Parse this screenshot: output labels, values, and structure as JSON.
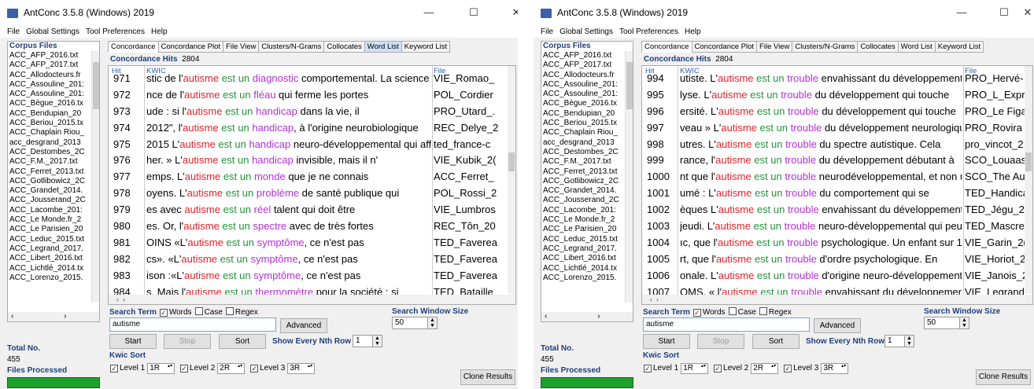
{
  "windows": [
    {
      "title": "AntConc 3.5.8 (Windows) 2019",
      "menu": [
        "File",
        "Global Settings",
        "Tool Preferences",
        "Help"
      ],
      "corpus_files_label": "Corpus Files",
      "files": [
        "ACC_AFP_2016.txt",
        "ACC_AFP_2017.txt",
        "ACC_Allodocteurs.fr",
        "ACC_Assouline_201:",
        "ACC_Assouline_201:",
        "ACC_Bègue_2016.tx",
        "ACC_Bendupian_20",
        "ACC_Beriou_2015.tx",
        "ACC_Chaplain Riou_",
        "acc_desgrand_2013",
        "ACC_Destombes_2C",
        "ACC_F.M._2017.txt",
        "ACC_Ferret_2013.txt",
        "ACC_Gotlibowicz_2C",
        "ACC_Grandet_2014.",
        "ACC_Jousserand_2C",
        "ACC_Lacombe_201:",
        "ACC_Le Monde.fr_2",
        "ACC_Le Parisien_20",
        "ACC_Leduc_2015.txt",
        "ACC_Legrand_2017.",
        "ACC_Libert_2016.txt",
        "ACC_Lichtlé_2014.tx",
        "ACC_Lorenzo_2015."
      ],
      "total_no_label": "Total No.",
      "total_no": "455",
      "files_processed_label": "Files Processed",
      "tabs": [
        "Concordance",
        "Concordance Plot",
        "File View",
        "Clusters/N-Grams",
        "Collocates",
        "Word List",
        "Keyword List"
      ],
      "concordance_hits_label": "Concordance Hits",
      "concordance_hits": "2804",
      "col_hit": "Hit",
      "col_kwic": "KWIC",
      "col_file": "File",
      "rows": [
        {
          "hit": "971",
          "left": "stic de l'",
          "t1": "autisme",
          "t2": "est",
          "t3": "un",
          "t3w": "diagnostic",
          "right": " comportemental. La science d",
          "file": "VIE_Romao_"
        },
        {
          "hit": "972",
          "left": "nce de l'",
          "t1": "autisme",
          "t2": "est",
          "t3": "un",
          "t3w": "fléau",
          "right": " qui ferme les portes",
          "file": "POL_Cordier"
        },
        {
          "hit": "973",
          "left": "ude : si l'",
          "t1": "autisme",
          "t2": "est",
          "t3": "un",
          "t3w": "handicap",
          "right": " dans la vie, il",
          "file": "PRO_Utard_."
        },
        {
          "hit": "974",
          "left": " 2012\", l'",
          "t1": "autisme",
          "t2": "est",
          "t3": "un",
          "t3w": "handicap",
          "right": ", à l'origine neurobiologique",
          "file": "REC_Delye_2"
        },
        {
          "hit": "975",
          "left": " 2015  L'",
          "t1": "autisme",
          "t2": "est",
          "t3": "un",
          "t3w": "handicap",
          "right": " neuro-développemental qui aff",
          "file": "ted_france-c"
        },
        {
          "hit": "976",
          "left": "her. »  L'",
          "t1": "autisme",
          "t2": "est",
          "t3": "un",
          "t3w": "handicap",
          "right": " invisible, mais il n'",
          "file": "VIE_Kubik_2("
        },
        {
          "hit": "977",
          "left": "emps. L'",
          "t1": "autisme",
          "t2": "est",
          "t3": "un",
          "t3w": "monde",
          "right": " que je ne connais",
          "file": "ACC_Ferret_"
        },
        {
          "hit": "978",
          "left": "oyens. L'",
          "t1": "autisme",
          "t2": "est",
          "t3": "un",
          "t3w": "problème",
          "right": " de santé publique qui",
          "file": "POL_Rossi_2"
        },
        {
          "hit": "979",
          "left": "es avec ",
          "t1": "autisme",
          "t2": "est",
          "t3": "un",
          "t3w": "réel",
          "right": " talent qui doit être",
          "file": "VIE_Lumbros"
        },
        {
          "hit": "980",
          "left": "es. Or, l'",
          "t1": "autisme",
          "t2": "est",
          "t3": "un",
          "t3w": "spectre",
          "right": " avec de très fortes",
          "file": "REC_Tôn_20"
        },
        {
          "hit": "981",
          "left": "OINS «L'",
          "t1": "autisme",
          "t2": "est",
          "t3": "un",
          "t3w": "symptôme",
          "right": ", ce n'est pas",
          "file": "TED_Faverea"
        },
        {
          "hit": "982",
          "left": "cs».  «L'",
          "t1": "autisme",
          "t2": "est",
          "t3": "un",
          "t3w": "symptôme",
          "right": ", ce n'est pas",
          "file": "TED_Faverea"
        },
        {
          "hit": "983",
          "left": "ison :«L'",
          "t1": "autisme",
          "t2": "est",
          "t3": "un",
          "t3w": "symptôme",
          "right": ", ce n'est pas",
          "file": "TED_Faverea"
        },
        {
          "hit": "984",
          "left": "s. Mais l'",
          "t1": "autisme",
          "t2": "est",
          "t3": "un",
          "t3w": "thermomètre",
          "right": " pour la société : si",
          "file": "TED_Bataille"
        }
      ],
      "search_term_label": "Search Term",
      "words_label": "Words",
      "case_label": "Case",
      "regex_label": "Regex",
      "search_value": "autisme",
      "advanced_label": "Advanced",
      "search_window_label": "Search Window Size",
      "search_window_value": "50",
      "start_label": "Start",
      "stop_label": "Stop",
      "sort_label": "Sort",
      "nth_row_label": "Show Every Nth Row",
      "nth_row_value": "1",
      "kwic_sort_label": "Kwic Sort",
      "level1_label": "Level 1",
      "level1_value": "1R",
      "level2_label": "Level 2",
      "level2_value": "2R",
      "level3_label": "Level 3",
      "level3_value": "3R",
      "clone_label": "Clone Results"
    },
    {
      "title": "AntConc 3.5.8 (Windows) 2019",
      "menu": [
        "File",
        "Global Settings",
        "Tool Preferences",
        "Help"
      ],
      "corpus_files_label": "Corpus Files",
      "files": [
        "ACC_AFP_2016.txt",
        "ACC_AFP_2017.txt",
        "ACC_Allodocteurs.fr",
        "ACC_Assouline_201:",
        "ACC_Assouline_201:",
        "ACC_Bègue_2016.tx",
        "ACC_Bendupian_20",
        "ACC_Beriou_2015.tx",
        "ACC_Chaplain Riou_",
        "acc_desgrand_2013",
        "ACC_Destombes_2C",
        "ACC_F.M._2017.txt",
        "ACC_Ferret_2013.txt",
        "ACC_Gotlibowicz_2C",
        "ACC_Grandet_2014.",
        "ACC_Jousserand_2C",
        "ACC_Lacombe_201:",
        "ACC_Le Monde.fr_2",
        "ACC_Le Parisien_20",
        "ACC_Leduc_2015.txt",
        "ACC_Legrand_2017.",
        "ACC_Libert_2016.txt",
        "ACC_Lichtlé_2014.tx",
        "ACC_Lorenzo_2015."
      ],
      "total_no_label": "Total No.",
      "total_no": "455",
      "files_processed_label": "Files Processed",
      "tabs": [
        "Concordance",
        "Concordance Plot",
        "File View",
        "Clusters/N-Grams",
        "Collocates",
        "Word List",
        "Keyword List"
      ],
      "concordance_hits_label": "Concordance Hits",
      "concordance_hits": "2804",
      "col_hit": "Hit",
      "col_kwic": "KWIC",
      "col_file": "File",
      "rows": [
        {
          "hit": "994",
          "left": "utiste. L'",
          "t1": "autisme",
          "t2": "est",
          "t3": "un",
          "t3w": "trouble",
          "right": " envahissant du développement. J",
          "file": "PRO_Hervé-"
        },
        {
          "hit": "995",
          "left": "lyse.  L'",
          "t1": "autisme",
          "t2": "est",
          "t3": "un",
          "t3w": "trouble",
          "right": " du développement qui touche",
          "file": "PRO_L_Expre"
        },
        {
          "hit": "996",
          "left": "ersité. L'",
          "t1": "autisme",
          "t2": "est",
          "t3": "un",
          "t3w": "trouble",
          "right": " du développement qui touche",
          "file": "PRO_Le Figa"
        },
        {
          "hit": "997",
          "left": "veau » L'",
          "t1": "autisme",
          "t2": "est",
          "t3": "un",
          "t3w": "trouble",
          "right": " du développement neurologique",
          "file": "PRO_Rovira"
        },
        {
          "hit": "998",
          "left": "utres. L'",
          "t1": "autisme",
          "t2": "est",
          "t3": "un",
          "t3w": "trouble",
          "right": " du spectre autistique. Cela",
          "file": "pro_vincot_2"
        },
        {
          "hit": "999",
          "left": "rance, l'",
          "t1": "autisme",
          "t2": "est",
          "t3": "un",
          "t3w": "trouble",
          "right": " du développement débutant à",
          "file": "SCO_Louaas"
        },
        {
          "hit": "1000",
          "left": "nt que l'",
          "t1": "autisme",
          "t2": "est",
          "t3": "un",
          "t3w": "trouble",
          "right": " neurodéveloppemental, et non un",
          "file": "SCO_The Au"
        },
        {
          "hit": "1001",
          "left": "umé : L'",
          "t1": "autisme",
          "t2": "est",
          "t3": "un",
          "t3w": "trouble",
          "right": " du comportement qui se",
          "file": "TED_Handica"
        },
        {
          "hit": "1002",
          "left": "èques  L'",
          "t1": "autisme",
          "t2": "est",
          "t3": "un",
          "t3w": "trouble",
          "right": " envahissant du développement  \\",
          "file": "TED_Jégu_2("
        },
        {
          "hit": "1003",
          "left": "jeudi.  L'",
          "t1": "autisme",
          "t2": "est",
          "t3": "un",
          "t3w": "trouble",
          "right": " neuro-développemental qui peut",
          "file": "TED_Mascret"
        },
        {
          "hit": "1004",
          "left": "ıc, que l'",
          "t1": "autisme",
          "t2": "est",
          "t3": "un",
          "t3w": "trouble",
          "right": " psychologique.  Un enfant sur 1(",
          "file": "VIE_Garin_2("
        },
        {
          "hit": "1005",
          "left": "rt, que l'",
          "t1": "autisme",
          "t2": "est",
          "t3": "un",
          "t3w": "trouble",
          "right": " d'ordre psychologique. En",
          "file": "VIE_Horiot_2"
        },
        {
          "hit": "1006",
          "left": "onale. L'",
          "t1": "autisme",
          "t2": "est",
          "t3": "un",
          "t3w": "trouble",
          "right": " d'origine neuro-développementa",
          "file": "VIE_Janois_2"
        },
        {
          "hit": "1007",
          "left": "OMS, « l'",
          "t1": "autisme",
          "t2": "est",
          "t3": "un",
          "t3w": "trouble",
          "right": " envahissant du développement (",
          "file": "VIE_Legrand"
        }
      ],
      "search_term_label": "Search Term",
      "words_label": "Words",
      "case_label": "Case",
      "regex_label": "Regex",
      "search_value": "autisme",
      "advanced_label": "Advanced",
      "search_window_label": "Search Window Size",
      "search_window_value": "50",
      "start_label": "Start",
      "stop_label": "Stop",
      "sort_label": "Sort",
      "nth_row_label": "Show Every Nth Row",
      "nth_row_value": "1",
      "kwic_sort_label": "Kwic Sort",
      "level1_label": "Level 1",
      "level1_value": "1R",
      "level2_label": "Level 2",
      "level2_value": "2R",
      "level3_label": "Level 3",
      "level3_value": "3R",
      "clone_label": "Clone Results"
    }
  ],
  "colors": {
    "accent": "#1f3f7a",
    "term1": "#e5222a",
    "term2": "#25923b",
    "term3": "#b32fd8",
    "progress": "#1ca12c"
  },
  "icons": [
    "app-icon",
    "minimize-icon",
    "maximize-icon",
    "close-icon",
    "checkbox-icon",
    "spinner-arrows-icon"
  ],
  "window_controls": {
    "minimize": "—",
    "maximize": "☐",
    "close": "✕"
  }
}
